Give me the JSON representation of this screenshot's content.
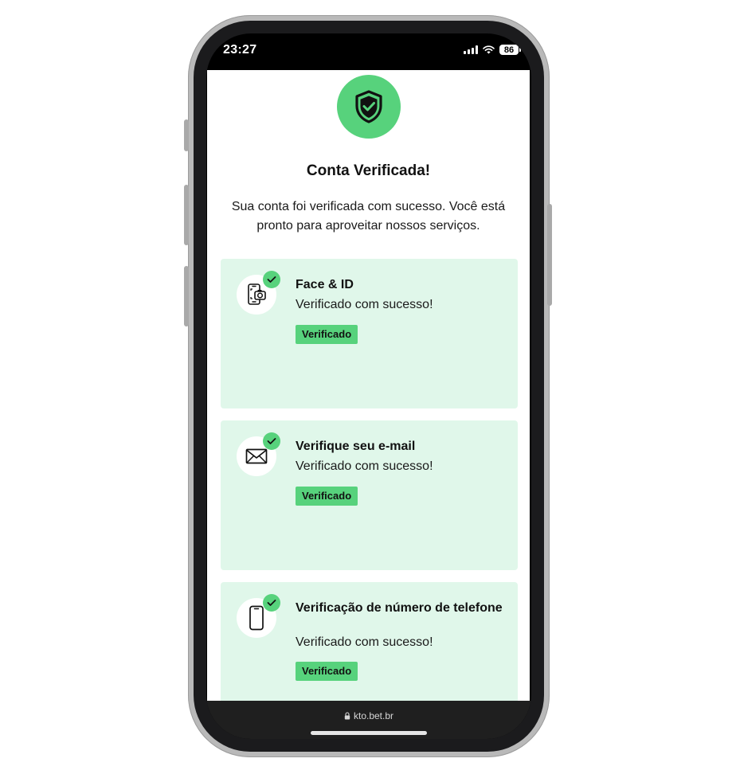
{
  "status_bar": {
    "time": "23:27",
    "battery": "86",
    "icons": [
      "signal-icon",
      "wifi-icon",
      "battery-icon"
    ]
  },
  "page": {
    "title": "Conta Verificada!",
    "description": "Sua conta foi verificada com sucesso. Você está pronto para aproveitar nossos serviços.",
    "hero_icon": "shield-check-icon"
  },
  "cards": [
    {
      "title": "Face & ID",
      "subtitle": "Verificado com sucesso!",
      "badge": "Verificado",
      "icon": "face-id-phone-icon"
    },
    {
      "title": "Verifique seu e-mail",
      "subtitle": "Verificado com sucesso!",
      "badge": "Verificado",
      "icon": "envelope-icon"
    },
    {
      "title": "Verificação de número de telefone",
      "subtitle": "Verificado com sucesso!",
      "badge": "Verificado",
      "icon": "phone-icon"
    }
  ],
  "browser": {
    "url": "kto.bet.br"
  },
  "colors": {
    "accent_green": "#57d27c",
    "card_background": "#e0f7ea",
    "text_dark": "#111111"
  }
}
